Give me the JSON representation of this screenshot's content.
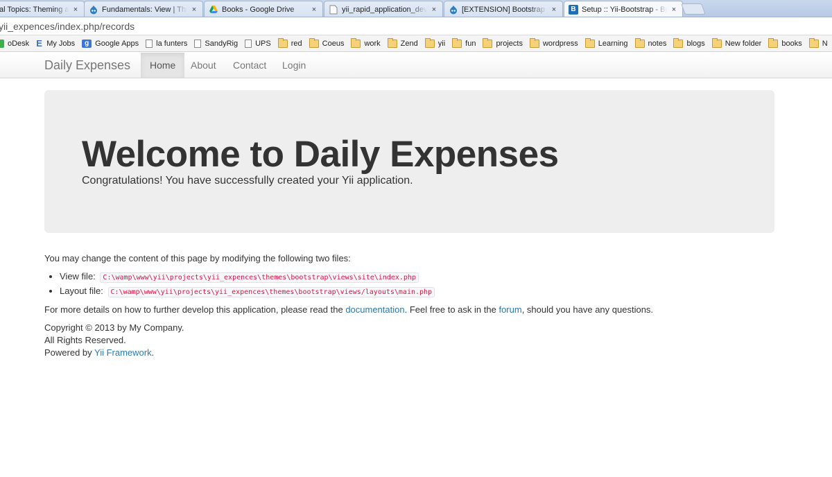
{
  "browser": {
    "tabs": [
      {
        "title": "al Topics: Theming a",
        "favicon": "none",
        "active": false
      },
      {
        "title": "Fundamentals: View | The",
        "favicon": "drupal-icon",
        "active": false
      },
      {
        "title": "Books - Google Drive",
        "favicon": "google-drive-icon",
        "active": false
      },
      {
        "title": "yii_rapid_application_deve",
        "favicon": "page-icon",
        "active": false
      },
      {
        "title": "[EXTENSION] Bootstrap - \\",
        "favicon": "drupal-icon",
        "active": false
      },
      {
        "title": "Setup :: Yii-Bootstrap - Bri",
        "favicon": "bootstrap-icon",
        "active": true
      }
    ],
    "close_glyph": "×",
    "url": "yii_expences/index.php/records",
    "bookmarks": [
      {
        "label": "oDesk",
        "icon": "odesk-icon"
      },
      {
        "label": "My Jobs",
        "icon": "e-icon"
      },
      {
        "label": "Google Apps",
        "icon": "google-apps-icon"
      },
      {
        "label": "la funters",
        "icon": "page-icon"
      },
      {
        "label": "SandyRig",
        "icon": "page-icon"
      },
      {
        "label": "UPS",
        "icon": "page-icon"
      },
      {
        "label": "red",
        "icon": "folder-icon"
      },
      {
        "label": "Coeus",
        "icon": "folder-icon"
      },
      {
        "label": "work",
        "icon": "folder-icon"
      },
      {
        "label": "Zend",
        "icon": "folder-icon"
      },
      {
        "label": "yii",
        "icon": "folder-icon"
      },
      {
        "label": "fun",
        "icon": "folder-icon"
      },
      {
        "label": "projects",
        "icon": "folder-icon"
      },
      {
        "label": "wordpress",
        "icon": "folder-icon"
      },
      {
        "label": "Learning",
        "icon": "folder-icon"
      },
      {
        "label": "notes",
        "icon": "folder-icon"
      },
      {
        "label": "blogs",
        "icon": "folder-icon"
      },
      {
        "label": "New folder",
        "icon": "folder-icon"
      },
      {
        "label": "books",
        "icon": "folder-icon"
      },
      {
        "label": "N",
        "icon": "folder-icon"
      }
    ]
  },
  "navbar": {
    "brand": "Daily Expenses",
    "links": [
      {
        "label": "Home",
        "active": true
      },
      {
        "label": "About",
        "active": false
      },
      {
        "label": "Contact",
        "active": false
      },
      {
        "label": "Login",
        "active": false
      }
    ]
  },
  "hero": {
    "title": "Welcome to Daily Expenses",
    "subtitle": "Congratulations! You have successfully created your Yii application."
  },
  "content": {
    "intro": "You may change the content of this page by modifying the following two files:",
    "files": [
      {
        "label": "View file:",
        "path": "C:\\wamp\\www\\yii\\projects\\yii_expences\\themes\\bootstrap\\views\\site\\index.php"
      },
      {
        "label": "Layout file:",
        "path": "C:\\wamp\\www\\yii\\projects\\yii_expences\\themes\\bootstrap\\views/layouts\\main.php"
      }
    ],
    "more_before": "For more details on how to further develop this application, please read the ",
    "documentation_link": "documentation",
    "more_middle": ". Feel free to ask in the ",
    "forum_link": "forum",
    "more_after": ", should you have any questions."
  },
  "footer": {
    "copyright": "Copyright © 2013 by My Company.",
    "rights": "All Rights Reserved.",
    "powered_before": "Powered by ",
    "powered_link": "Yii Framework",
    "powered_after": "."
  },
  "colors": {
    "link": "#2a7ab0",
    "hero_bg": "#eeeeee",
    "code_text": "#dd1144"
  }
}
